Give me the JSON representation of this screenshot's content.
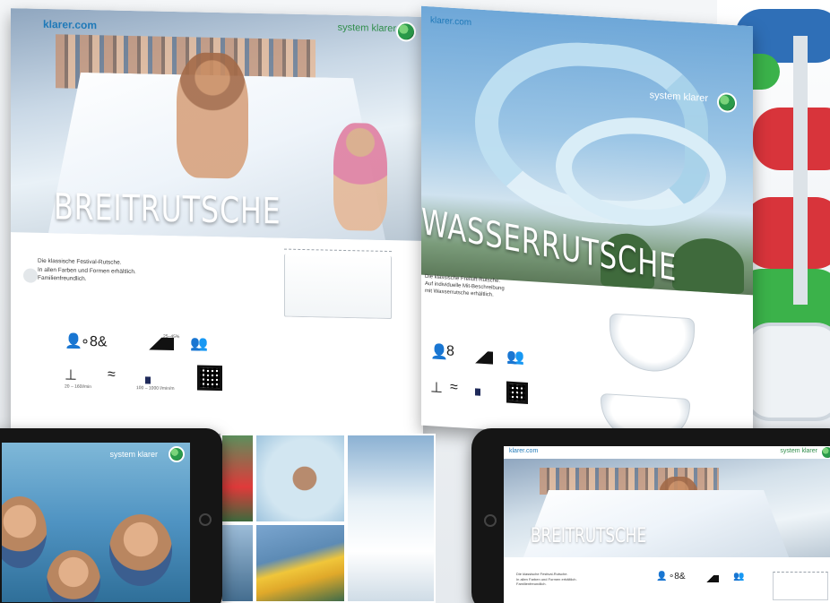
{
  "spread_left": {
    "brand": "klarer.com",
    "system_label": "system klarer",
    "title": "BREITRUTSCHE",
    "description_lines": [
      "Die klassische Festival-Rutsche.",
      "In allen Farben und Formen erhältlich.",
      "Familienfreundlich."
    ],
    "icon_labels": {
      "ramp_label": "25–45%",
      "flow_label": "20 – 160l/min",
      "length_label": "100 – 1000 l/min/m"
    }
  },
  "spread_right": {
    "brand": "klarer.com",
    "system_label": "system klarer",
    "title": "WASSERRUTSCHE",
    "description_lines": [
      "Die klassische Freiluft-Rutsche.",
      "Auf individuelle Mit-Beschreibung",
      "mit Wasserrutsche erhältlich."
    ]
  },
  "tablet_left": {
    "system_label": "system klarer"
  },
  "tablet_right": {
    "brand": "klarer.com",
    "system_label": "system klarer",
    "title": "BREITRUTSCHE"
  },
  "colors": {
    "brand_blue": "#1f79b8",
    "brand_green": "#2f8d4a"
  },
  "icons": [
    "person-icon",
    "groups-icon",
    "ramp-icon",
    "people-icon",
    "tap-icon",
    "waves-icon",
    "bars-icon",
    "qr-code-icon",
    "logo-icon"
  ]
}
